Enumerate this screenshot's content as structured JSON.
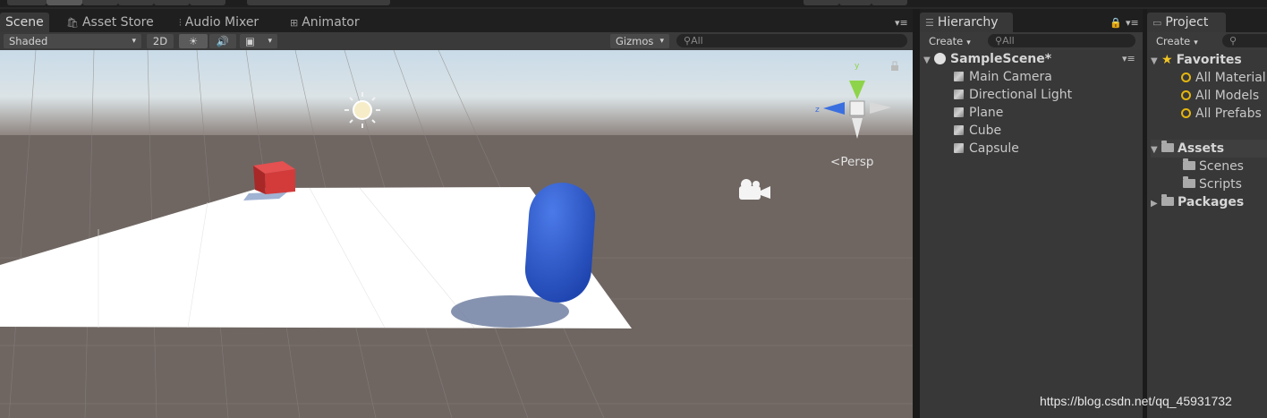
{
  "scene_tabs": [
    {
      "label": "Scene",
      "icon": "scene-icon",
      "active": true
    },
    {
      "label": "Asset Store",
      "icon": "asset-store-icon"
    },
    {
      "label": "Audio Mixer",
      "icon": "audio-mixer-icon"
    },
    {
      "label": "Animator",
      "icon": "animator-icon"
    }
  ],
  "scene_toolbar": {
    "shading_mode": "Shaded",
    "mode_2d": "2D",
    "gizmos": "Gizmos",
    "search_placeholder": "All"
  },
  "scene_view": {
    "projection_label": "Persp",
    "objects": [
      "Main Camera",
      "Directional Light",
      "Plane",
      "Cube",
      "Capsule"
    ],
    "colors": {
      "sky": "#c9dbe8",
      "ground": "#6f6662",
      "plane": "#ffffff",
      "cube": "#d43b3b",
      "capsule": "#2f5fd0"
    }
  },
  "hierarchy": {
    "tab_label": "Hierarchy",
    "create_label": "Create",
    "search_placeholder": "All",
    "scene_name": "SampleScene*",
    "items": [
      {
        "label": "Main Camera"
      },
      {
        "label": "Directional Light"
      },
      {
        "label": "Plane"
      },
      {
        "label": "Cube"
      },
      {
        "label": "Capsule"
      }
    ]
  },
  "project": {
    "tab_label": "Project",
    "create_label": "Create",
    "favorites_label": "Favorites",
    "favorites": [
      {
        "label": "All Material"
      },
      {
        "label": "All Models"
      },
      {
        "label": "All Prefabs"
      }
    ],
    "assets_label": "Assets",
    "asset_folders": [
      {
        "label": "Scenes"
      },
      {
        "label": "Scripts"
      }
    ],
    "packages_label": "Packages"
  },
  "watermark": "https://blog.csdn.net/qq_45931732"
}
